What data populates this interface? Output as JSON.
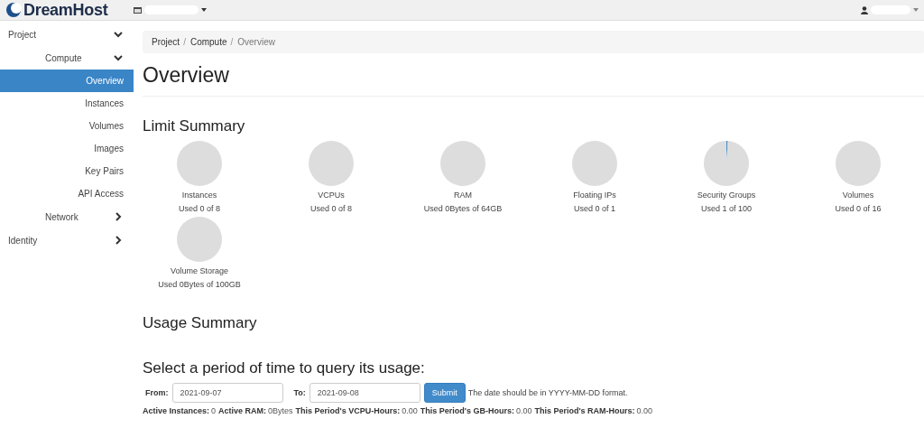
{
  "header": {
    "logo": "DreamHost"
  },
  "sidebar": {
    "items": [
      {
        "label": "Project",
        "expanded": true,
        "children": [
          {
            "label": "Compute",
            "expanded": true,
            "children": [
              {
                "label": "Overview",
                "selected": true
              },
              {
                "label": "Instances",
                "selected": false
              },
              {
                "label": "Volumes",
                "selected": false
              },
              {
                "label": "Images",
                "selected": false
              },
              {
                "label": "Key Pairs",
                "selected": false
              },
              {
                "label": "API Access",
                "selected": false
              }
            ]
          },
          {
            "label": "Network",
            "expanded": false
          }
        ]
      },
      {
        "label": "Identity",
        "expanded": false
      }
    ]
  },
  "breadcrumb": {
    "items": [
      "Project",
      "Compute",
      "Overview"
    ],
    "separator": "/"
  },
  "page_title": "Overview",
  "limit_summary": {
    "title": "Limit Summary",
    "quotas": [
      {
        "name": "Instances",
        "usage": "Used 0 of 8",
        "chart_data": {
          "type": "pie",
          "values": [
            0,
            100
          ]
        }
      },
      {
        "name": "VCPUs",
        "usage": "Used 0 of 8",
        "chart_data": {
          "type": "pie",
          "values": [
            0,
            100
          ]
        }
      },
      {
        "name": "RAM",
        "usage": "Used 0Bytes of 64GB",
        "chart_data": {
          "type": "pie",
          "values": [
            0,
            100
          ]
        }
      },
      {
        "name": "Floating IPs",
        "usage": "Used 0 of 1",
        "chart_data": {
          "type": "pie",
          "values": [
            0,
            100
          ]
        }
      },
      {
        "name": "Security Groups",
        "usage": "Used 1 of 100",
        "chart_data": {
          "type": "pie",
          "values": [
            1,
            99
          ]
        }
      },
      {
        "name": "Volumes",
        "usage": "Used 0 of 16",
        "chart_data": {
          "type": "pie",
          "values": [
            0,
            100
          ]
        }
      },
      {
        "name": "Volume Storage",
        "usage": "Used 0Bytes of 100GB",
        "chart_data": {
          "type": "pie",
          "values": [
            0,
            100
          ]
        }
      }
    ]
  },
  "usage_summary": {
    "title": "Usage Summary",
    "query_title": "Select a period of time to query its usage:",
    "from": {
      "label": "From:",
      "value": "2021-09-07"
    },
    "to": {
      "label": "To:",
      "value": "2021-09-08"
    },
    "submit": "Submit",
    "hint": "The date should be in YYYY-MM-DD format.",
    "stats": [
      {
        "label": "Active Instances:",
        "value": "0"
      },
      {
        "label": "Active RAM:",
        "value": "0Bytes"
      },
      {
        "label": "This Period's VCPU-Hours:",
        "value": "0.00"
      },
      {
        "label": "This Period's GB-Hours:",
        "value": "0.00"
      },
      {
        "label": "This Period's RAM-Hours:",
        "value": "0.00"
      }
    ]
  }
}
